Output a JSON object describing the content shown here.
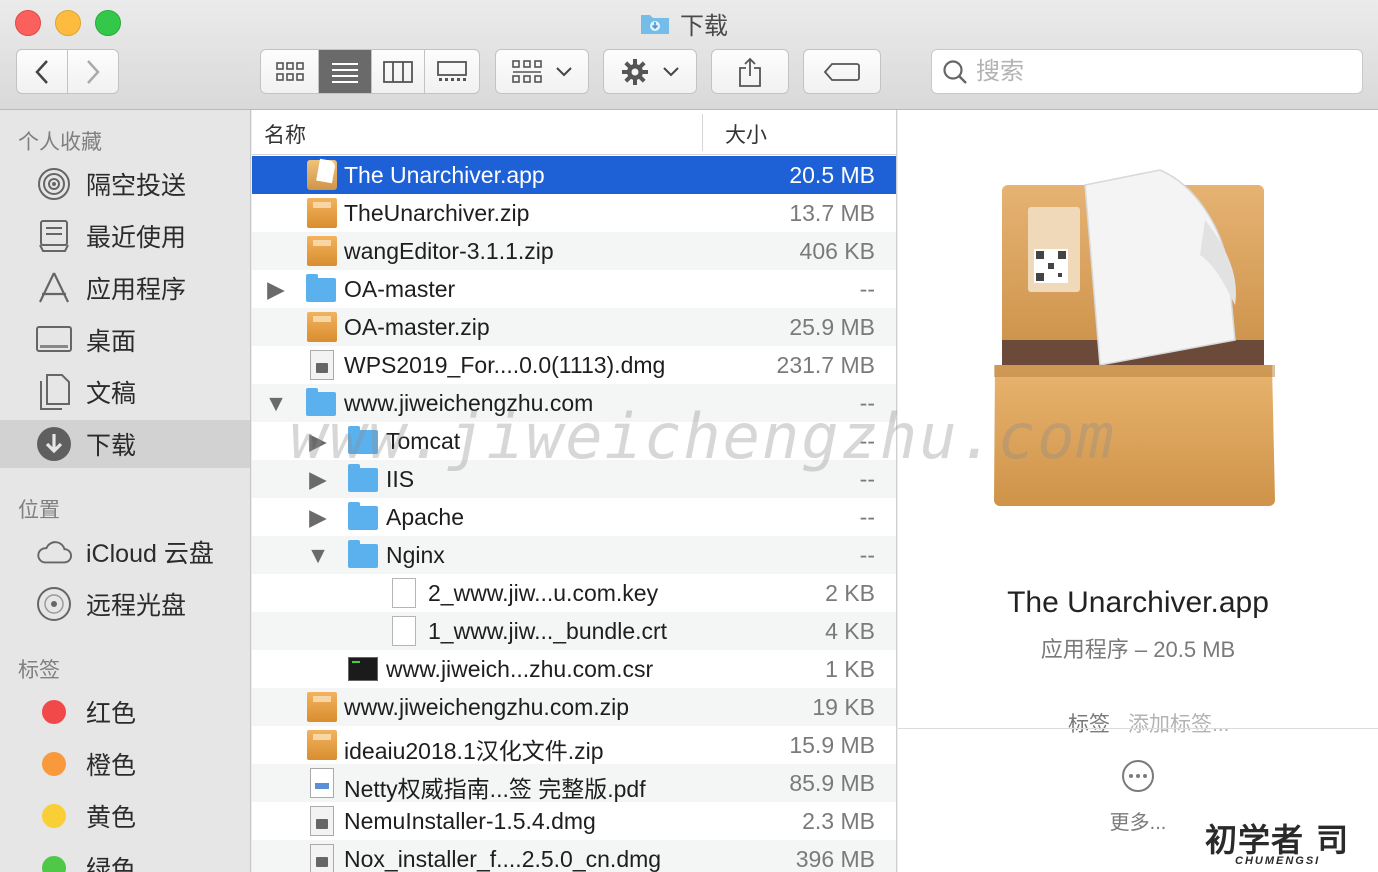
{
  "window": {
    "title": "下载"
  },
  "toolbar": {
    "search_placeholder": "搜索"
  },
  "sidebar": {
    "favorites_header": "个人收藏",
    "favorites": [
      {
        "label": "隔空投送",
        "icon": "airdrop-icon"
      },
      {
        "label": "最近使用",
        "icon": "recents-icon"
      },
      {
        "label": "应用程序",
        "icon": "applications-icon"
      },
      {
        "label": "桌面",
        "icon": "desktop-icon"
      },
      {
        "label": "文稿",
        "icon": "documents-icon"
      },
      {
        "label": "下载",
        "icon": "downloads-icon",
        "selected": true
      }
    ],
    "locations_header": "位置",
    "locations": [
      {
        "label": "iCloud 云盘",
        "icon": "icloud-icon"
      },
      {
        "label": "远程光盘",
        "icon": "remote-disc-icon"
      }
    ],
    "tags_header": "标签",
    "tags": [
      {
        "label": "红色",
        "color": "#f1484a"
      },
      {
        "label": "橙色",
        "color": "#f89a3c"
      },
      {
        "label": "黄色",
        "color": "#f9cf35"
      },
      {
        "label": "绿色",
        "color": "#4fc747"
      }
    ]
  },
  "filelist": {
    "col_name": "名称",
    "col_size": "大小",
    "rows": [
      {
        "name": "The Unarchiver.app",
        "size": "20.5 MB",
        "icon": "app-icon"
      },
      {
        "name": "TheUnarchiver.zip",
        "size": "13.7 MB",
        "icon": "zip-icon"
      },
      {
        "name": "wangEditor-3.1.1.zip",
        "size": "406 KB",
        "icon": "zip-icon"
      },
      {
        "name": "OA-master",
        "size": "--",
        "icon": "folder-icon"
      },
      {
        "name": "OA-master.zip",
        "size": "25.9 MB",
        "icon": "zip-icon"
      },
      {
        "name": "WPS2019_For....0.0(1113).dmg",
        "size": "231.7 MB",
        "icon": "dmg-icon"
      },
      {
        "name": "www.jiweichengzhu.com",
        "size": "--",
        "icon": "folder-icon"
      },
      {
        "name": "Tomcat",
        "size": "--",
        "icon": "folder-icon"
      },
      {
        "name": "IIS",
        "size": "--",
        "icon": "folder-icon"
      },
      {
        "name": "Apache",
        "size": "--",
        "icon": "folder-icon"
      },
      {
        "name": "Nginx",
        "size": "--",
        "icon": "folder-icon"
      },
      {
        "name": "2_www.jiw...u.com.key",
        "size": "2 KB",
        "icon": "document-icon"
      },
      {
        "name": "1_www.jiw..._bundle.crt",
        "size": "4 KB",
        "icon": "document-icon"
      },
      {
        "name": "www.jiweich...zhu.com.csr",
        "size": "1 KB",
        "icon": "terminal-icon"
      },
      {
        "name": "www.jiweichengzhu.com.zip",
        "size": "19 KB",
        "icon": "zip-icon"
      },
      {
        "name": "ideaiu2018.1汉化文件.zip",
        "size": "15.9 MB",
        "icon": "zip-icon"
      },
      {
        "name": "Netty权威指南...签 完整版.pdf",
        "size": "85.9 MB",
        "icon": "pdf-icon"
      },
      {
        "name": "NemuInstaller-1.5.4.dmg",
        "size": "2.3 MB",
        "icon": "dmg-icon"
      },
      {
        "name": "Nox_installer_f....2.5.0_cn.dmg",
        "size": "396 MB",
        "icon": "dmg-icon"
      }
    ]
  },
  "preview": {
    "name": "The Unarchiver.app",
    "meta": "应用程序 – 20.5 MB",
    "tags_label": "标签",
    "add_tags": "添加标签...",
    "more": "更多..."
  },
  "watermark": "www.jiweichengzhu.com",
  "brand": {
    "mark": "初学者 司",
    "sub": "CHUMENGSI"
  }
}
